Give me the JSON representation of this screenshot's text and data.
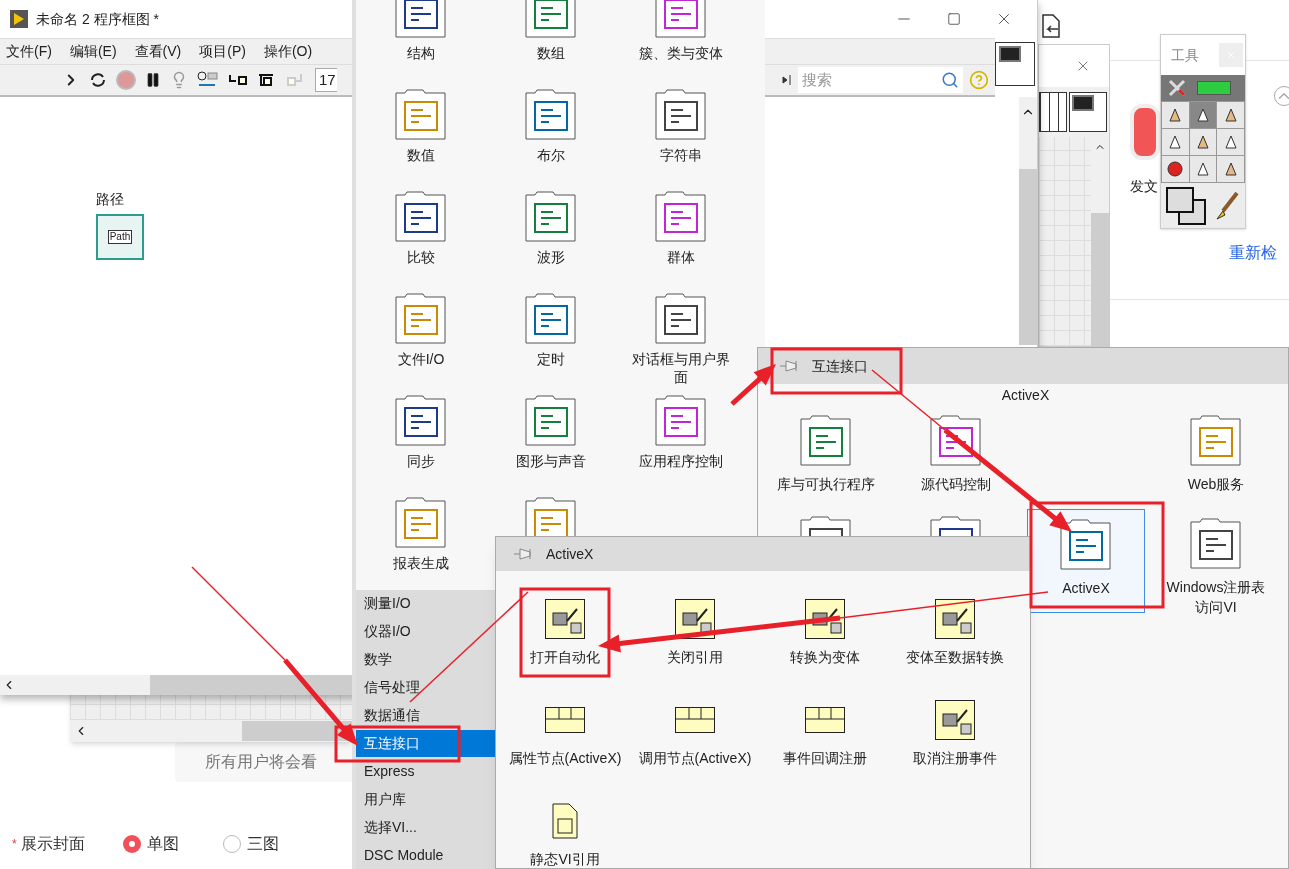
{
  "diagram_window": {
    "title": "未命名 2 程序框图 *",
    "menu": [
      "文件(F)",
      "编辑(E)",
      "查看(V)",
      "项目(P)",
      "操作(O)"
    ],
    "font_field": "17",
    "path_label": "路径",
    "path_text": "Path"
  },
  "palette": {
    "search_placeholder": "搜索",
    "items": [
      {
        "label": "结构"
      },
      {
        "label": "数组"
      },
      {
        "label": "簇、类与变体"
      },
      {
        "label": "数值"
      },
      {
        "label": "布尔"
      },
      {
        "label": "字符串"
      },
      {
        "label": "比较"
      },
      {
        "label": "波形"
      },
      {
        "label": "群体"
      },
      {
        "label": "文件I/O"
      },
      {
        "label": "定时"
      },
      {
        "label": "对话框与用户界面"
      },
      {
        "label": "同步"
      },
      {
        "label": "图形与声音"
      },
      {
        "label": "应用程序控制"
      },
      {
        "label": "报表生成"
      }
    ],
    "categories": [
      {
        "label": "测量I/O",
        "selected": false
      },
      {
        "label": "仪器I/O",
        "selected": false
      },
      {
        "label": "数学",
        "selected": false
      },
      {
        "label": "信号处理",
        "selected": false
      },
      {
        "label": "数据通信",
        "selected": false
      },
      {
        "label": "互连接口",
        "selected": true
      },
      {
        "label": "Express",
        "selected": false
      },
      {
        "label": "用户库",
        "selected": false
      },
      {
        "label": "选择VI...",
        "selected": false
      },
      {
        "label": "DSC Module",
        "selected": false
      }
    ]
  },
  "tools_palette": {
    "title": "工具"
  },
  "interconnect_palette": {
    "title": "互连接口",
    "group": "ActiveX",
    "items": [
      {
        "label": "库与可执行程序",
        "selected": false
      },
      {
        "label": "源代码控制",
        "selected": false
      },
      {
        "label": "Web服务",
        "selected": false
      },
      {
        "label": "ActiveX",
        "selected": true
      },
      {
        "label": "Windows注册表访问VI",
        "selected": false
      }
    ]
  },
  "activex_palette": {
    "title": "ActiveX",
    "items": [
      {
        "label": "打开自动化"
      },
      {
        "label": "关闭引用"
      },
      {
        "label": "转换为变体"
      },
      {
        "label": "变体至数据转换"
      },
      {
        "label": "属性节点(ActiveX)"
      },
      {
        "label": "调用节点(ActiveX)"
      },
      {
        "label": "事件回调注册"
      },
      {
        "label": "取消注册事件"
      },
      {
        "label": "静态VI引用"
      }
    ]
  },
  "web_page": {
    "publish_label": "发文",
    "recheck_link": "重新检",
    "notice": "所有用户将会看",
    "cover_required": "*",
    "cover_label": "展示封面",
    "cover_options": [
      {
        "label": "单图",
        "selected": true
      },
      {
        "label": "三图",
        "selected": false
      }
    ]
  }
}
